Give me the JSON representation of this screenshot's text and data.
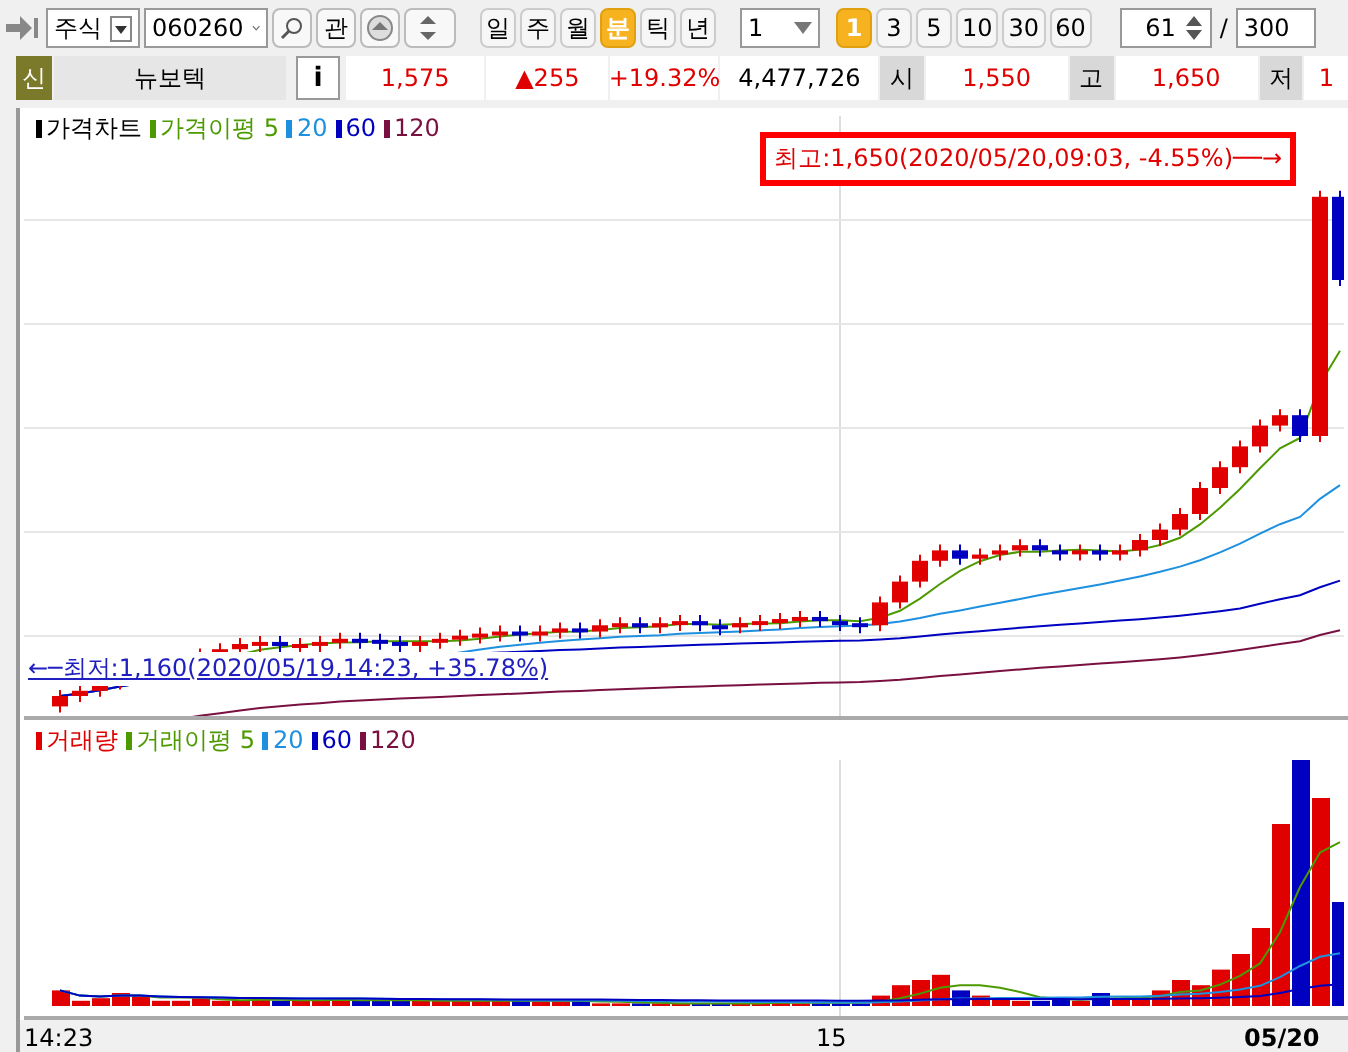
{
  "toolbar": {
    "market": "주식",
    "code": "060260",
    "interest": "관",
    "periods": [
      {
        "label": "일",
        "selected": false
      },
      {
        "label": "주",
        "selected": false
      },
      {
        "label": "월",
        "selected": false
      },
      {
        "label": "분",
        "selected": true
      },
      {
        "label": "틱",
        "selected": false
      },
      {
        "label": "년",
        "selected": false
      }
    ],
    "interval": "1",
    "minutes": [
      {
        "label": "1",
        "selected": true
      },
      {
        "label": "3",
        "selected": false
      },
      {
        "label": "5",
        "selected": false
      },
      {
        "label": "10",
        "selected": false
      },
      {
        "label": "30",
        "selected": false
      },
      {
        "label": "60",
        "selected": false
      }
    ],
    "count": "61",
    "separator": "/",
    "total": "300"
  },
  "quote": {
    "badge": "신",
    "name": "뉴보텍",
    "info": "i",
    "price": "1,575",
    "change": "▲255",
    "rate": "+19.32%",
    "volume": "4,477,726",
    "open_label": "시",
    "open": "1,550",
    "high_label": "고",
    "high": "1,650",
    "low_label": "저",
    "low": "1"
  },
  "price_panel": {
    "legend": [
      {
        "label": "가격차트",
        "color": "#000000"
      },
      {
        "label": "가격이평 5",
        "color": "#4c9a00"
      },
      {
        "label": "20",
        "color": "#1e90e0"
      },
      {
        "label": "60",
        "color": "#0000c0"
      },
      {
        "label": "120",
        "color": "#7a1040"
      }
    ],
    "high_note": "최고:1,650(2020/05/20,09:03, -4.55%)──→",
    "low_note": "←─최저:1,160(2020/05/19,14:23, +35.78%)"
  },
  "volume_panel": {
    "legend": [
      {
        "label": "거래량",
        "color": "#e00000"
      },
      {
        "label": "거래이평 5",
        "color": "#4c9a00"
      },
      {
        "label": "20",
        "color": "#1e90e0"
      },
      {
        "label": "60",
        "color": "#0000c0"
      },
      {
        "label": "120",
        "color": "#7a1040"
      }
    ]
  },
  "x_axis": {
    "labels": [
      "14:23",
      "15",
      "05/20"
    ]
  }
}
